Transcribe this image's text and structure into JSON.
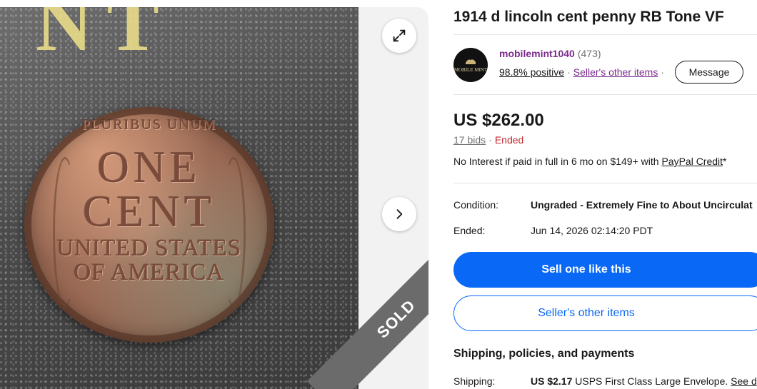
{
  "listing": {
    "title": "1914 d lincoln cent penny RB Tone VF",
    "sold_banner": "SOLD"
  },
  "coin_image": {
    "motto": "PLURIBUS UNUM",
    "one": "ONE",
    "cent": "CENT",
    "country_line1": "UNITED STATES",
    "country_line2": "OF AMERICA",
    "background_letters": "NT"
  },
  "seller": {
    "name": "mobilemint1040",
    "feedback_count": "(473)",
    "positive": "98.8% positive",
    "separator": "·",
    "other_items": "Seller's other items",
    "message_button": "Message",
    "avatar_label": "MOBILE MINT"
  },
  "pricing": {
    "price": "US $262.00",
    "bids": "17 bids",
    "status": "Ended",
    "credit_text": "No Interest if paid in full in 6 mo on $149+ with ",
    "credit_link": "PayPal Credit",
    "credit_suffix": "*"
  },
  "details": {
    "condition_label": "Condition:",
    "condition_value": "Ungraded - Extremely Fine to About Uncirculat",
    "ended_label": "Ended:",
    "ended_value": "Jun 14, 2026 02:14:20 PDT"
  },
  "actions": {
    "sell_button": "Sell one like this",
    "other_items_button": "Seller's other items"
  },
  "shipping": {
    "heading": "Shipping, policies, and payments",
    "label": "Shipping:",
    "price": "US $2.17",
    "method": " USPS First Class Large Envelope. ",
    "see_link": "See d"
  },
  "colors": {
    "primary_blue": "#0968f6",
    "seller_purple": "#7a2c8c",
    "ended_red": "#c0272d",
    "sold_band": "#6b6b6b"
  },
  "icons": {
    "expand": "expand-icon",
    "next": "chevron-right-icon"
  }
}
